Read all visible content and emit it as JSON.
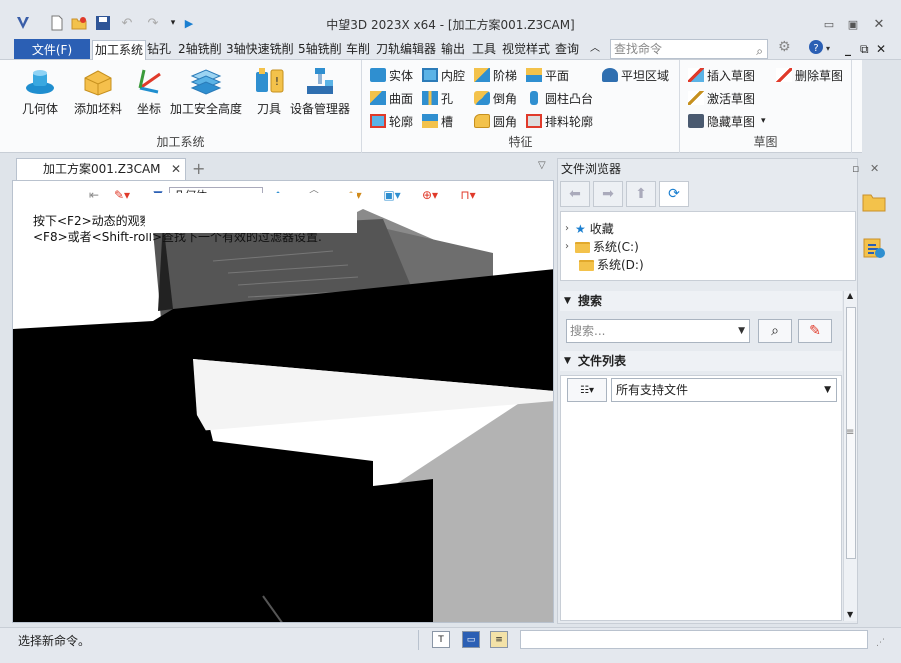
{
  "window": {
    "title": "中望3D 2023X x64 - [加工方案001.Z3CAM]"
  },
  "menubar": {
    "file_label": "文件(F)",
    "tabs": [
      "加工系统",
      "钻孔",
      "2轴铣削",
      "3轴快速铣削",
      "5轴铣削",
      "车削",
      "刀轨编辑器",
      "输出",
      "工具",
      "视觉样式",
      "查询"
    ],
    "active_tab": "加工系统",
    "search_placeholder": "查找命令"
  },
  "ribbon": {
    "groups": {
      "system": {
        "label": "加工系统",
        "buttons": [
          "几何体",
          "添加坯料",
          "坐标",
          "加工安全高度",
          "刀具",
          "设备管理器"
        ]
      },
      "features": {
        "label": "特征",
        "items": [
          "实体",
          "内腔",
          "阶梯",
          "平面",
          "平坦区域",
          "曲面",
          "孔",
          "倒角",
          "圆柱凸台",
          "轮廓",
          "槽",
          "圆角",
          "排料轮廓"
        ]
      },
      "sketch": {
        "label": "草图",
        "items": [
          "插入草图",
          "删除草图",
          "激活草图",
          "隐藏草图"
        ]
      }
    }
  },
  "document": {
    "tab_label": "加工方案001.Z3CAM",
    "filter_value": "几何体",
    "hint_line1": "按下<F2>动态的观察",
    "hint_line2": "<F8>或者<Shift-roll>查找下一个有效的过滤器设置."
  },
  "file_browser": {
    "title": "文件浏览器",
    "tree": [
      "收藏",
      "系统(C:)",
      "系统(D:)"
    ],
    "search_section": "搜索",
    "search_placeholder": "搜索...",
    "filelist_section": "文件列表",
    "file_type": "所有支持文件"
  },
  "status": {
    "message": "选择新命令。"
  },
  "colors": {
    "accent": "#2b5fb4",
    "refresh_blue": "#1b7fd0",
    "folder_yellow": "#f3c24b"
  }
}
